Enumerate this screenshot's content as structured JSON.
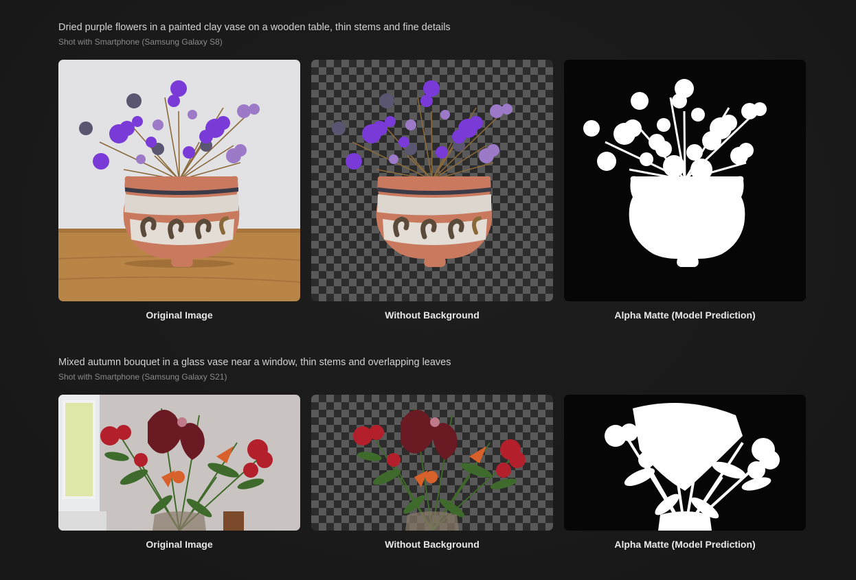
{
  "sections": [
    {
      "title": "Dried purple flowers in a painted clay vase on a wooden table, thin stems and fine details",
      "subtitle": "Shot with Smartphone (Samsung Galaxy S8)",
      "captions": [
        "Original Image",
        "Without Background",
        "Alpha Matte (Model Prediction)"
      ]
    },
    {
      "title": "Mixed autumn bouquet in a glass vase near a window, thin stems and overlapping leaves",
      "subtitle": "Shot with Smartphone (Samsung Galaxy S21)",
      "captions": [
        "Original Image",
        "Without Background",
        "Alpha Matte (Model Prediction)"
      ]
    }
  ],
  "colors": {
    "page_background": "#1a1a1a",
    "checker_light": "#595959",
    "checker_dark": "#2c2c2c",
    "matte_background": "#060606",
    "matte_foreground": "#ffffff",
    "flower_purple": "#7a3ad8",
    "vase_terracotta": "#c97a5e",
    "table_wood": "#b98546",
    "bouquet_red": "#b3202c",
    "bouquet_orange": "#d8602a"
  }
}
